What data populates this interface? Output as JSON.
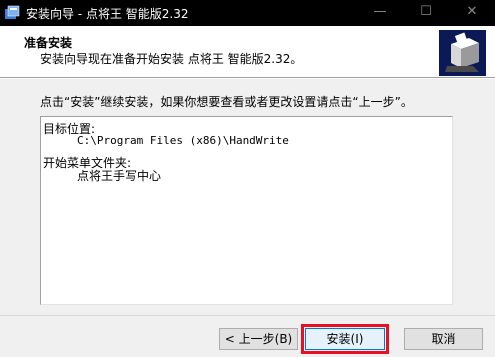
{
  "window": {
    "title": "安装向导 - 点将王 智能版2.32",
    "minimize_glyph": "—",
    "maximize_glyph": "☐",
    "close_glyph": "✕"
  },
  "header": {
    "title": "准备安装",
    "subtitle": "安装向导现在准备开始安装 点将王 智能版2.32。"
  },
  "main": {
    "instruction": "点击“安装”继续安装，如果你想要查看或者更改设置请点击“上一步”。",
    "summary": {
      "dest_label": "目标位置:",
      "dest_value": "C:\\Program Files (x86)\\HandWrite",
      "menu_label": "开始菜单文件夹:",
      "menu_value": "点将王手写中心"
    }
  },
  "buttons": {
    "back": "< 上一步(B)",
    "install": "安装(I)",
    "cancel": "取消"
  },
  "colors": {
    "titlebar": "#000000",
    "focus_highlight": "#e81123",
    "logo_bg": "#0b1a56"
  }
}
